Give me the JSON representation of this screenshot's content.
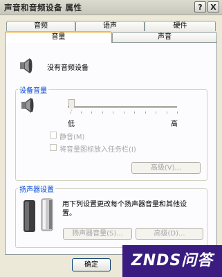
{
  "window": {
    "title": "声音和音频设备 属性",
    "help_label": "?",
    "close_label": "X"
  },
  "tabs_back": [
    "音频",
    "语声",
    "硬件"
  ],
  "tabs_front": [
    "音量",
    "声音"
  ],
  "active_tab_index": 0,
  "device": {
    "name": "没有音频设备"
  },
  "device_volume": {
    "legend": "设备音量",
    "slider_low": "低",
    "slider_high": "高",
    "slider_value": 0,
    "mute_label": "静音(M)",
    "mute_checked": false,
    "tray_icon_label": "将音量图标放入任务栏(I)",
    "tray_icon_checked": false,
    "advanced_button": "高级(V)..."
  },
  "speaker_settings": {
    "legend": "扬声器设置",
    "description": [
      "用下列设置更改每个扬声器音量和其他设",
      "置。"
    ],
    "speaker_volume_button": "扬声器音量(S)...",
    "advanced_button": "高级(D)..."
  },
  "footer": {
    "ok_button": "确定"
  },
  "watermark": {
    "text": "ZNDS问答"
  },
  "colors": {
    "accent": "#f5b53d",
    "legend": "#0046d5",
    "watermark_bg": "#3a1c80"
  }
}
